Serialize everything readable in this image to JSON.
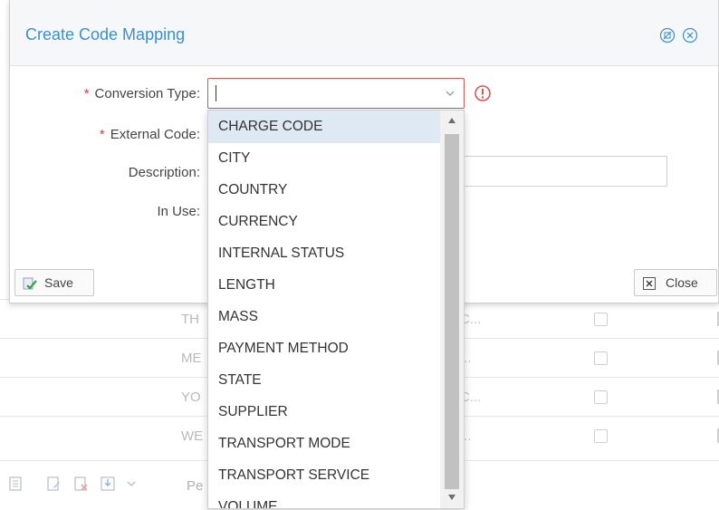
{
  "dialog": {
    "title": "Create Code Mapping",
    "fields": {
      "conversion_type": "Conversion Type:",
      "external_code": "External Code:",
      "description": "Description:",
      "in_use": "In Use:"
    },
    "save_label": "Save",
    "close_label": "Close",
    "required_mark": "*"
  },
  "dropdown": {
    "selected": "CHARGE CODE",
    "options": [
      "CHARGE CODE",
      "CITY",
      "COUNTRY",
      "CURRENCY",
      "INTERNAL STATUS",
      "LENGTH",
      "MASS",
      "PAYMENT METHOD",
      "STATE",
      "SUPPLIER",
      "TRANSPORT MODE",
      "TRANSPORT SERVICE",
      "VOLUME"
    ]
  },
  "background": {
    "rows": [
      {
        "col1": "TH",
        "col2": "C..."
      },
      {
        "col1": "ME",
        "col2": "..."
      },
      {
        "col1": "YO",
        "col2": "C..."
      },
      {
        "col1": "WE",
        "col2": "..."
      }
    ],
    "toolbar_label": "Pe"
  },
  "colors": {
    "accent": "#3a8fd1",
    "error": "#d9534f",
    "selected_bg": "#dfe9f3"
  }
}
